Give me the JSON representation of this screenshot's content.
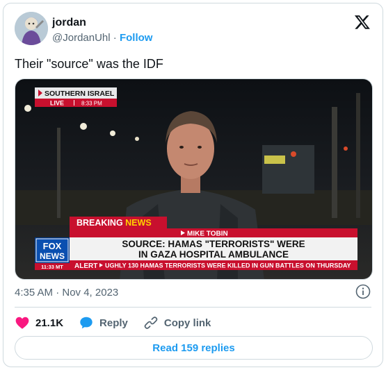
{
  "author": {
    "display_name": "jordan",
    "handle": "@JordanUhl",
    "separator": "·",
    "follow_label": "Follow"
  },
  "tweet": {
    "text": "Their \"source\" was the IDF",
    "timestamp": "4:35 AM · Nov 4, 2023"
  },
  "media": {
    "location_label": "SOUTHERN ISRAEL",
    "live_label": "LIVE",
    "live_time": "8:33 PM",
    "breaking_label_a": "BREAKING ",
    "breaking_label_b": "NEWS",
    "reporter": "MIKE TOBIN",
    "headline_line1": "SOURCE: HAMAS \"TERRORISTS\" WERE",
    "headline_line2": "IN GAZA HOSPITAL AMBULANCE",
    "network_line1": "FOX",
    "network_line2": "NEWS",
    "network_time": "11:33 MT",
    "alert_label": "ALERT",
    "ticker_text": "UGHLY 130 HAMAS TERRORISTS WERE KILLED IN GUN BATTLES ON THURSDAY"
  },
  "actions": {
    "likes": "21.1K",
    "reply_label": "Reply",
    "copy_link_label": "Copy link"
  },
  "read_replies_label": "Read 159 replies",
  "colors": {
    "like": "#f91880",
    "accent": "#1d9bf0",
    "fox_red": "#c8102e",
    "fox_blue": "#003a8c"
  }
}
